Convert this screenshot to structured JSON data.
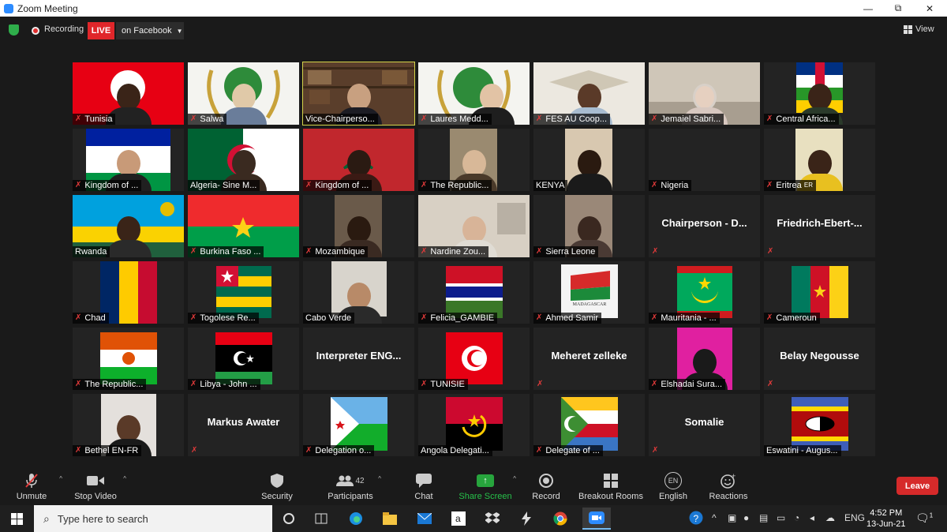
{
  "window": {
    "title": "Zoom Meeting",
    "minimize": "—",
    "maximize": "⧉",
    "close": "✕"
  },
  "topbar": {
    "recording_label": "Recording",
    "live_label": "LIVE",
    "stream_target": "on Facebook",
    "view_label": "View"
  },
  "participants": [
    {
      "name": "Tunisia",
      "muted": true
    },
    {
      "name": "Salwa",
      "muted": true
    },
    {
      "name": "Vice-Chairperso...",
      "muted": false,
      "active": true
    },
    {
      "name": "Laures Medd...",
      "muted": true
    },
    {
      "name": "FES AU Coop...",
      "muted": true
    },
    {
      "name": "Jemaiel Sabri...",
      "muted": true
    },
    {
      "name": "Central Africa...",
      "muted": true
    },
    {
      "name": "Kingdom of ...",
      "muted": true
    },
    {
      "name": "Algeria- Sine M...",
      "muted": false
    },
    {
      "name": "Kingdom of ...",
      "muted": true
    },
    {
      "name": "The Republic...",
      "muted": true
    },
    {
      "name": "KENYA",
      "muted": false
    },
    {
      "name": "Nigeria",
      "muted": true
    },
    {
      "name": "Eritrea",
      "muted": true,
      "badge": "ER"
    },
    {
      "name": "Rwanda",
      "muted": false
    },
    {
      "name": "Burkina Faso ...",
      "muted": true
    },
    {
      "name": "Mozambique",
      "muted": true
    },
    {
      "name": "Nardine Zou...",
      "muted": true
    },
    {
      "name": "Sierra Leone",
      "muted": true
    },
    {
      "name": "Chairperson - D...",
      "muted": true
    },
    {
      "name": "Friedrich-Ebert-...",
      "muted": true
    },
    {
      "name": "Chad",
      "muted": true
    },
    {
      "name": "Togolese Re...",
      "muted": true
    },
    {
      "name": "Cabo Verde",
      "muted": false
    },
    {
      "name": "Felicia_GAMBIE",
      "muted": true
    },
    {
      "name": "Ahmed Samir",
      "muted": true,
      "caption": "MADAGASCAR"
    },
    {
      "name": "Mauritania - ...",
      "muted": true
    },
    {
      "name": "Cameroun",
      "muted": true
    },
    {
      "name": "The Republic...",
      "muted": true
    },
    {
      "name": "Libya - John ...",
      "muted": true
    },
    {
      "name": "Interpreter ENG...",
      "muted": false
    },
    {
      "name": "TUNISIE",
      "muted": true
    },
    {
      "name": "Meheret zelleke",
      "muted": true
    },
    {
      "name": "Elshadai Sura...",
      "muted": true
    },
    {
      "name": "Belay Negousse",
      "muted": true
    },
    {
      "name": "Bethel EN-FR",
      "muted": true
    },
    {
      "name": "Markus Awater",
      "muted": true
    },
    {
      "name": "Delegation o...",
      "muted": true
    },
    {
      "name": "Angola Delegati...",
      "muted": false
    },
    {
      "name": "Delegate of ...",
      "muted": true
    },
    {
      "name": "Somalie",
      "muted": true
    },
    {
      "name": "Eswatini - Augus...",
      "muted": false
    }
  ],
  "controls": {
    "unmute": "Unmute",
    "stop_video": "Stop Video",
    "security": "Security",
    "participants": "Participants",
    "participants_count": "42",
    "chat": "Chat",
    "share_screen": "Share Screen",
    "record": "Record",
    "breakout": "Breakout Rooms",
    "language_code": "EN",
    "language": "English",
    "reactions": "Reactions",
    "leave": "Leave"
  },
  "taskbar": {
    "search_placeholder": "Type here to search",
    "lang": "ENG",
    "time": "4:52 PM",
    "date": "13-Jun-21",
    "notif_count": "1"
  },
  "colors": {
    "live": "#e0262a",
    "share": "#27a53d",
    "leave": "#d62a2a",
    "active_border": "#d4d44a"
  }
}
